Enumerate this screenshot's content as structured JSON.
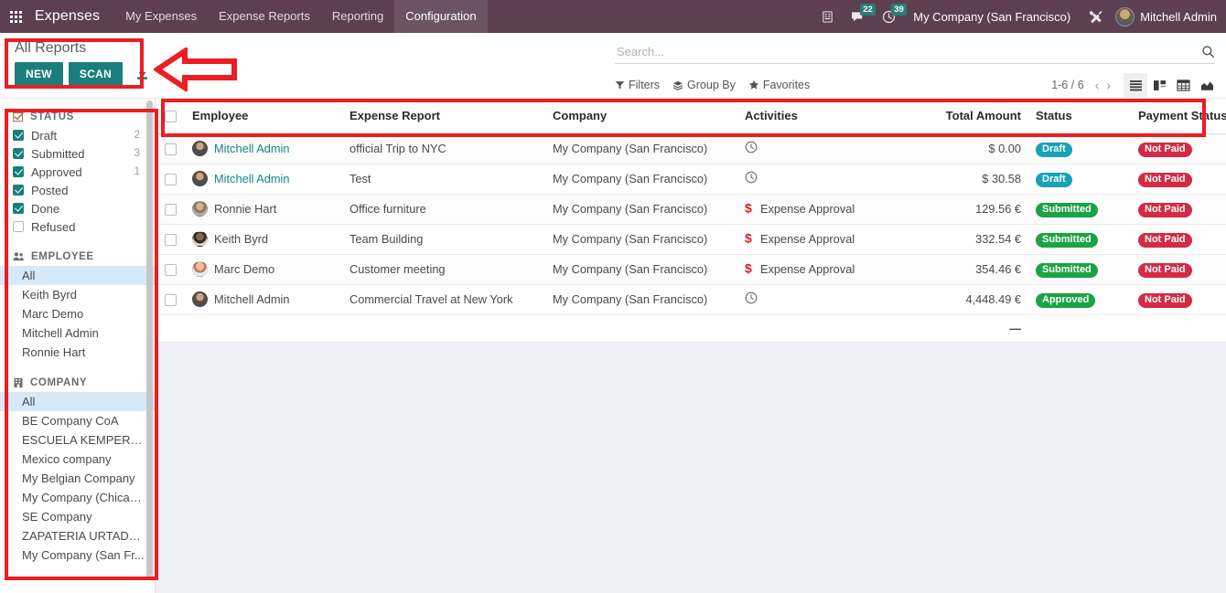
{
  "navbar": {
    "apps_icon": "grid-apps-icon",
    "brand": "Expenses",
    "menu": [
      {
        "label": "My Expenses",
        "active": false
      },
      {
        "label": "Expense Reports",
        "active": false
      },
      {
        "label": "Reporting",
        "active": false
      },
      {
        "label": "Configuration",
        "active": true
      }
    ],
    "icons": {
      "voip_icon": "phone-icon",
      "messaging_icon": "chat-icon",
      "messaging_count": "22",
      "activities_icon": "clock-icon",
      "activities_count": "39",
      "debug_icon": "tools-icon"
    },
    "company": "My Company (San Francisco)",
    "user": "Mitchell Admin"
  },
  "control_panel": {
    "title": "All Reports",
    "new_label": "NEW",
    "scan_label": "SCAN",
    "download_icon": "download-icon",
    "search": {
      "placeholder": "Search...",
      "value": "",
      "icon": "search-icon"
    },
    "filters_label": "Filters",
    "groupby_label": "Group By",
    "favorites_label": "Favorites",
    "pager": "1-6 / 6",
    "prev_icon": "chevron-left-icon",
    "next_icon": "chevron-right-icon",
    "views": [
      {
        "name": "list-view-icon",
        "active": true
      },
      {
        "name": "kanban-view-icon",
        "active": false
      },
      {
        "name": "pivot-view-icon",
        "active": false
      },
      {
        "name": "graph-view-icon",
        "active": false
      }
    ]
  },
  "sidebar": {
    "status": {
      "icon": "checkbox-icon",
      "title": "STATUS",
      "items": [
        {
          "label": "Draft",
          "checked": true,
          "count": "2"
        },
        {
          "label": "Submitted",
          "checked": true,
          "count": "3"
        },
        {
          "label": "Approved",
          "checked": true,
          "count": "1"
        },
        {
          "label": "Posted",
          "checked": true,
          "count": ""
        },
        {
          "label": "Done",
          "checked": true,
          "count": ""
        },
        {
          "label": "Refused",
          "checked": false,
          "count": ""
        }
      ]
    },
    "employee": {
      "icon": "people-icon",
      "title": "EMPLOYEE",
      "items": [
        {
          "label": "All",
          "selected": true
        },
        {
          "label": "Keith Byrd",
          "selected": false
        },
        {
          "label": "Marc Demo",
          "selected": false
        },
        {
          "label": "Mitchell Admin",
          "selected": false
        },
        {
          "label": "Ronnie Hart",
          "selected": false
        }
      ]
    },
    "company": {
      "icon": "building-icon",
      "title": "COMPANY",
      "items": [
        {
          "label": "All",
          "selected": true
        },
        {
          "label": "BE Company CoA",
          "selected": false
        },
        {
          "label": "ESCUELA KEMPER UR...",
          "selected": false
        },
        {
          "label": "Mexico company",
          "selected": false
        },
        {
          "label": "My Belgian Company",
          "selected": false
        },
        {
          "label": "My Company (Chicago)",
          "selected": false
        },
        {
          "label": "SE Company",
          "selected": false
        },
        {
          "label": "ZAPATERIA URTADO ...",
          "selected": false
        },
        {
          "label": "My Company (San Fr...",
          "selected": false
        }
      ]
    }
  },
  "list": {
    "columns": [
      "Employee",
      "Expense Report",
      "Company",
      "Activities",
      "Total Amount",
      "Status",
      "Payment Status"
    ],
    "optional_columns_icon": "column-settings-icon",
    "rows": [
      {
        "employee": "Mitchell Admin",
        "avatar": "av-mitchell",
        "report": "official Trip to NYC",
        "company": "My Company (San Francisco)",
        "activity_icon": "clock-icon",
        "activity": "",
        "amount": "$ 0.00",
        "status": "Draft",
        "status_color": "#17a2b8",
        "payment_status": "Not Paid",
        "payment_color": "#d32b44",
        "unread": true
      },
      {
        "employee": "Mitchell Admin",
        "avatar": "av-mitchell",
        "report": "Test",
        "company": "My Company (San Francisco)",
        "activity_icon": "clock-icon",
        "activity": "",
        "amount": "$ 30.58",
        "status": "Draft",
        "status_color": "#17a2b8",
        "payment_status": "Not Paid",
        "payment_color": "#d32b44",
        "unread": true
      },
      {
        "employee": "Ronnie Hart",
        "avatar": "av-ronnie",
        "report": "Office furniture",
        "company": "My Company (San Francisco)",
        "activity_icon": "dollar-icon",
        "activity": "Expense Approval",
        "amount": "129.56 €",
        "status": "Submitted",
        "status_color": "#1aa344",
        "payment_status": "Not Paid",
        "payment_color": "#d32b44",
        "unread": false
      },
      {
        "employee": "Keith Byrd",
        "avatar": "av-keith",
        "report": "Team Building",
        "company": "My Company (San Francisco)",
        "activity_icon": "dollar-icon",
        "activity": "Expense Approval",
        "amount": "332.54 €",
        "status": "Submitted",
        "status_color": "#1aa344",
        "payment_status": "Not Paid",
        "payment_color": "#d32b44",
        "unread": false
      },
      {
        "employee": "Marc Demo",
        "avatar": "av-marc",
        "report": "Customer meeting",
        "company": "My Company (San Francisco)",
        "activity_icon": "dollar-icon",
        "activity": "Expense Approval",
        "amount": "354.46 €",
        "status": "Submitted",
        "status_color": "#1aa344",
        "payment_status": "Not Paid",
        "payment_color": "#d32b44",
        "unread": false
      },
      {
        "employee": "Mitchell Admin",
        "avatar": "av-mitchell",
        "report": "Commercial Travel at New York",
        "company": "My Company (San Francisco)",
        "activity_icon": "clock-icon",
        "activity": "",
        "amount": "4,448.49 €",
        "status": "Approved",
        "status_color": "#1aa344",
        "payment_status": "Not Paid",
        "payment_color": "#d32b44",
        "unread": false
      }
    ],
    "aggregate": "—"
  },
  "annotations": {
    "color": "#ee1c23",
    "header_box": "highlight-box-all-reports",
    "sidebar_box": "highlight-box-filters",
    "table_header_box": "highlight-box-columns",
    "arrow": "left-pointing-arrow"
  }
}
